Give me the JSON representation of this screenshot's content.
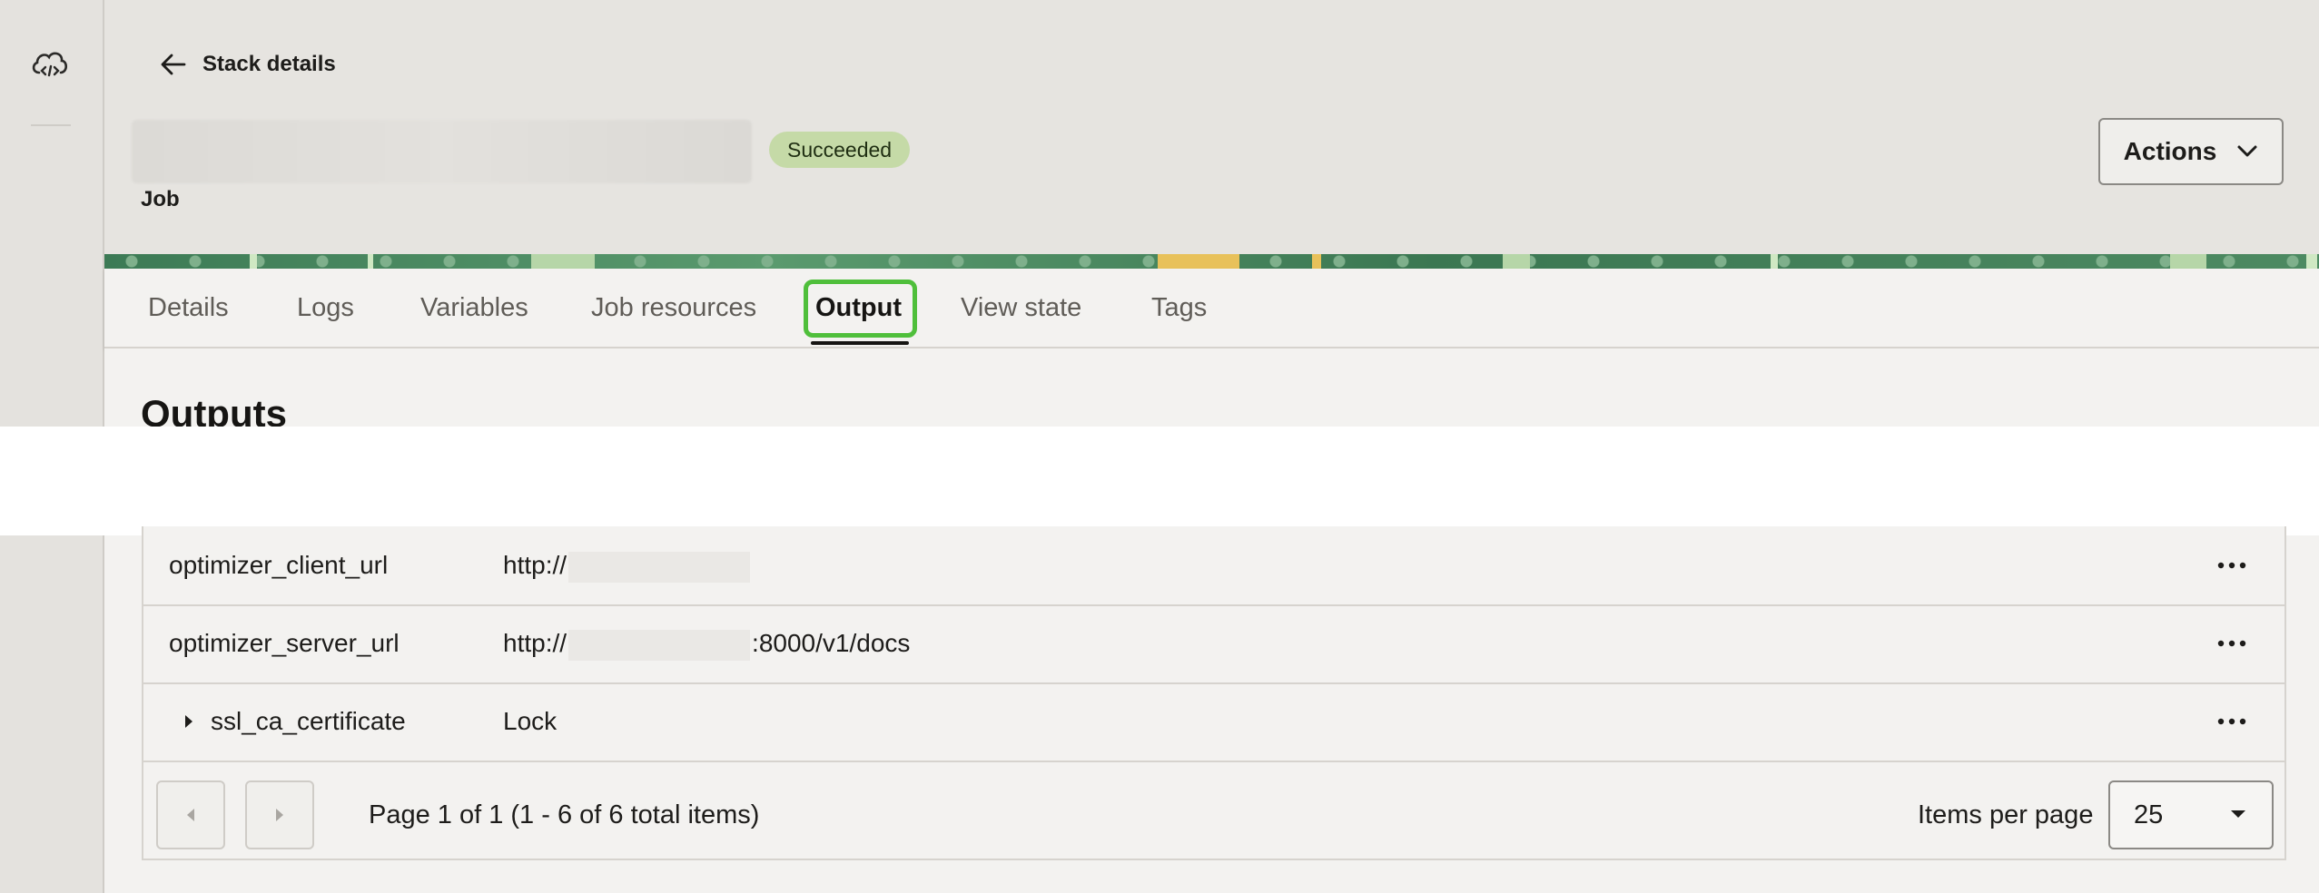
{
  "header": {
    "back_label": "Stack details",
    "status_badge": "Succeeded",
    "resource_type": "Job",
    "actions_label": "Actions"
  },
  "tabs": [
    {
      "label": "Details",
      "active": false
    },
    {
      "label": "Logs",
      "active": false
    },
    {
      "label": "Variables",
      "active": false
    },
    {
      "label": "Job resources",
      "active": false
    },
    {
      "label": "Output",
      "active": true
    },
    {
      "label": "View state",
      "active": false
    },
    {
      "label": "Tags",
      "active": false
    }
  ],
  "page_title": "Outputs",
  "rows": [
    {
      "name": "optimizer_client_url",
      "value_prefix": "http://",
      "value_suffix": ""
    },
    {
      "name": "optimizer_server_url",
      "value_prefix": "http://",
      "value_suffix": ":8000/v1/docs"
    },
    {
      "name": "ssl_ca_certificate",
      "value": "Lock"
    }
  ],
  "pagination": {
    "info": "Page 1 of 1 (1 - 6 of 6 total items)",
    "items_per_page_label": "Items per page",
    "items_per_page_value": "25"
  },
  "colors": {
    "highlight": "#4fbf3b",
    "badge_bg": "#c5daa7",
    "sidebar_bg": "#e4e2de"
  },
  "icons": [
    "cloud-code-icon",
    "arrow-left-icon",
    "chevron-down-icon",
    "ellipsis-icon",
    "caret-right-icon",
    "caret-left-icon",
    "caret-down-icon"
  ]
}
